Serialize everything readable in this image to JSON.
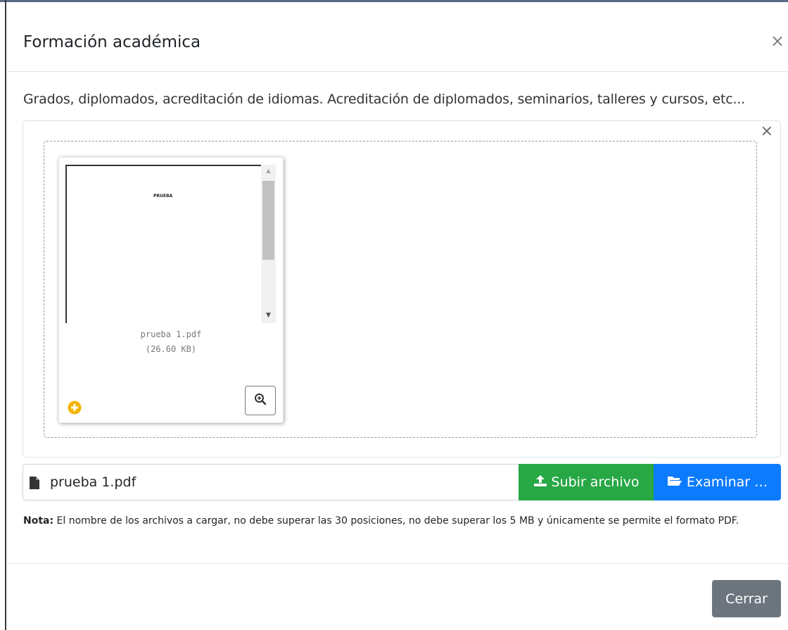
{
  "modal": {
    "title": "Formación académica",
    "close_symbol": "×",
    "description": "Grados, diplomados, acreditación de idiomas. Acreditación de diplomados, seminarios, talleres y cursos, etc..."
  },
  "preview": {
    "remove_symbol": "×",
    "file": {
      "name": "prueba 1.pdf",
      "size": "(26.60 KB)",
      "page_text": "PRUEBA",
      "status_icon": "plus-circle-icon",
      "zoom_icon": "zoom-in-icon",
      "scroll_up": "▲",
      "scroll_down": "▼"
    }
  },
  "upload": {
    "caption_icon": "file-icon",
    "caption_text": "prueba 1.pdf",
    "upload_button_label": "Subir archivo",
    "upload_icon": "upload-icon",
    "browse_button_label": "Examinar …",
    "browse_icon": "folder-open-icon"
  },
  "note": {
    "label": "Nota:",
    "text": "El nombre de los archivos a cargar, no debe superar las 30 posiciones, no debe superar los 5 MB y únicamente se permite el formato PDF."
  },
  "footer": {
    "close_button_label": "Cerrar"
  },
  "colors": {
    "upload_button": "#28a745",
    "browse_button": "#0d7bfd",
    "close_button": "#6c757d",
    "status_icon": "#f4b400"
  }
}
